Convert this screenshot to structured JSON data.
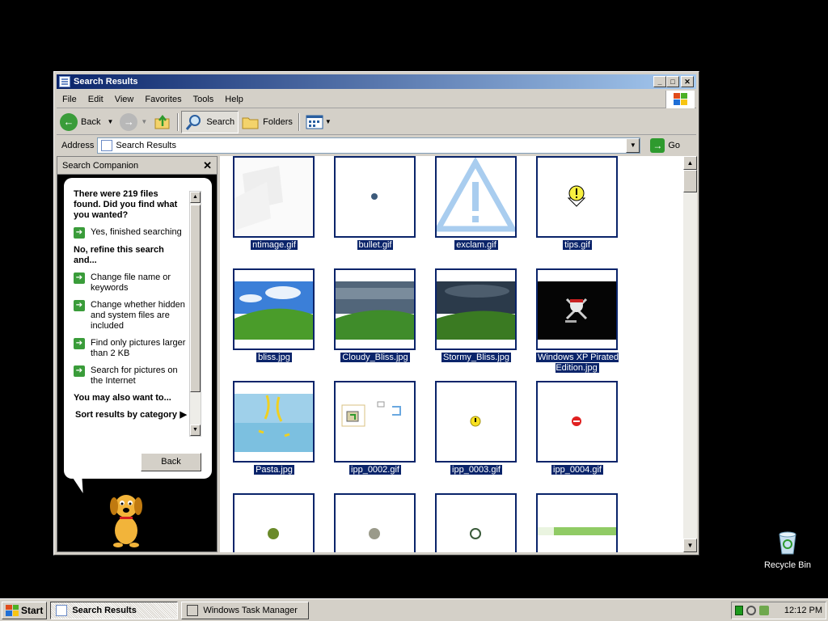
{
  "window": {
    "title": "Search Results"
  },
  "menu": [
    "File",
    "Edit",
    "View",
    "Favorites",
    "Tools",
    "Help"
  ],
  "toolbar": {
    "back": "Back",
    "search": "Search",
    "folders": "Folders"
  },
  "address": {
    "label": "Address",
    "value": "Search Results",
    "go": "Go"
  },
  "companion": {
    "header": "Search Companion",
    "found_text": "There were 219 files found. Did you find what you wanted?",
    "yes": "Yes, finished searching",
    "refine_heading": "No, refine this search and...",
    "options": [
      "Change file name or keywords",
      "Change whether hidden and system files are included",
      "Find only pictures larger than 2 KB",
      "Search for pictures on the Internet"
    ],
    "also_heading": "You may also want to...",
    "sort": "Sort results by category",
    "back_button": "Back"
  },
  "files": [
    {
      "name": "ntimage.gif",
      "kind": "ntimage"
    },
    {
      "name": "bullet.gif",
      "kind": "bullet"
    },
    {
      "name": "exclam.gif",
      "kind": "exclam"
    },
    {
      "name": "tips.gif",
      "kind": "tips"
    },
    {
      "name": "bliss.jpg",
      "kind": "bliss"
    },
    {
      "name": "Cloudy_Bliss.jpg",
      "kind": "cloudy"
    },
    {
      "name": "Stormy_Bliss.jpg",
      "kind": "stormy"
    },
    {
      "name": "Windows XP Pirated Edition.jpg",
      "kind": "pirate"
    },
    {
      "name": "Pasta.jpg",
      "kind": "pasta"
    },
    {
      "name": "ipp_0002.gif",
      "kind": "ipp2"
    },
    {
      "name": "ipp_0003.gif",
      "kind": "ipp3"
    },
    {
      "name": "ipp_0004.gif",
      "kind": "ipp4"
    },
    {
      "name": "",
      "kind": "dotgreen"
    },
    {
      "name": "",
      "kind": "dotgray"
    },
    {
      "name": "",
      "kind": "dotring"
    },
    {
      "name": "",
      "kind": "stripe"
    }
  ],
  "desktop": {
    "recycle_bin": "Recycle Bin"
  },
  "taskbar": {
    "start": "Start",
    "tasks": [
      "Search Results",
      "Windows Task Manager"
    ],
    "clock": "12:12 PM"
  },
  "colors": {
    "selection": "#0a246a",
    "title_start": "#0a246a",
    "title_end": "#a6caf0",
    "desktop": "#000000"
  }
}
